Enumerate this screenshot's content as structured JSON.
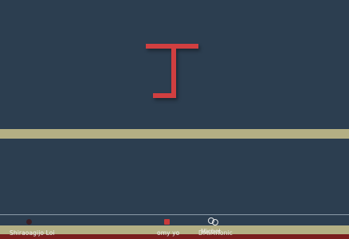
{
  "colors": {
    "background": "#2c3e50",
    "piece": "#d13f40",
    "band": "#b3af84",
    "track_line": "#8b9aa8",
    "bottom_red": "#7a1e1e"
  },
  "players": [
    {
      "name": "Shiraoagijo Loi",
      "marker_color": "#3b1f25",
      "marker_shape": "dot"
    },
    {
      "name": "omy yo",
      "marker_color": "#c93a3a",
      "marker_shape": "square"
    },
    {
      "name": "Michel",
      "marker_color": "#ffffff",
      "marker_shape": "ring"
    },
    {
      "name": "DMIMiTonic",
      "marker_color": "#ffffff",
      "marker_shape": "ring"
    }
  ]
}
